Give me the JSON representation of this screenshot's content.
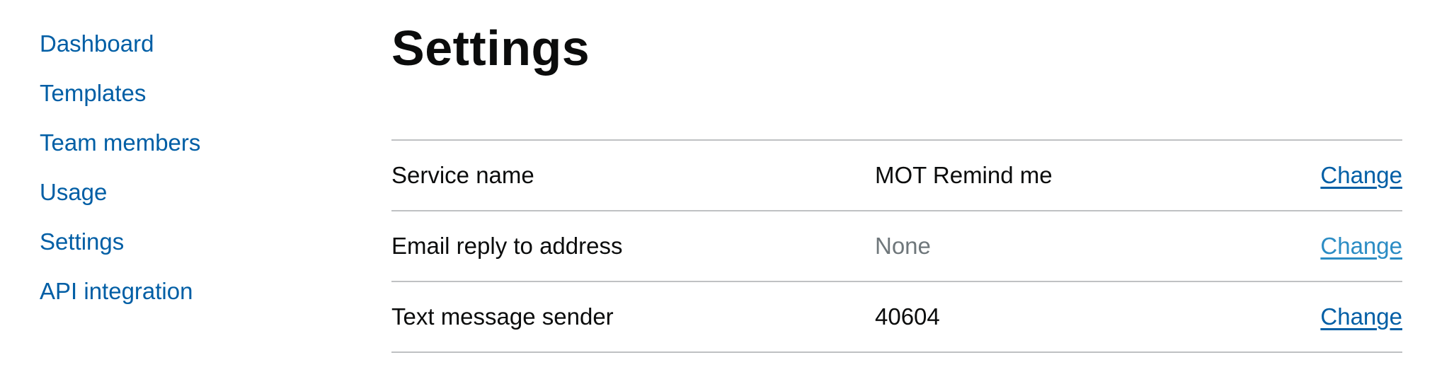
{
  "nav": {
    "items": [
      {
        "label": "Dashboard"
      },
      {
        "label": "Templates"
      },
      {
        "label": "Team members"
      },
      {
        "label": "Usage"
      },
      {
        "label": "Settings"
      },
      {
        "label": "API integration"
      }
    ]
  },
  "page": {
    "title": "Settings"
  },
  "settings": {
    "rows": [
      {
        "key": "Service name",
        "value": "MOT Remind me",
        "action": "Change"
      },
      {
        "key": "Email reply to address",
        "value": "None",
        "action": "Change"
      },
      {
        "key": "Text message sender",
        "value": "40604",
        "action": "Change"
      }
    ]
  },
  "colors": {
    "link": "#005ea5",
    "link_hover": "#2b8cc4",
    "secondary_text": "#6f777b",
    "border": "#bfc1c3"
  }
}
